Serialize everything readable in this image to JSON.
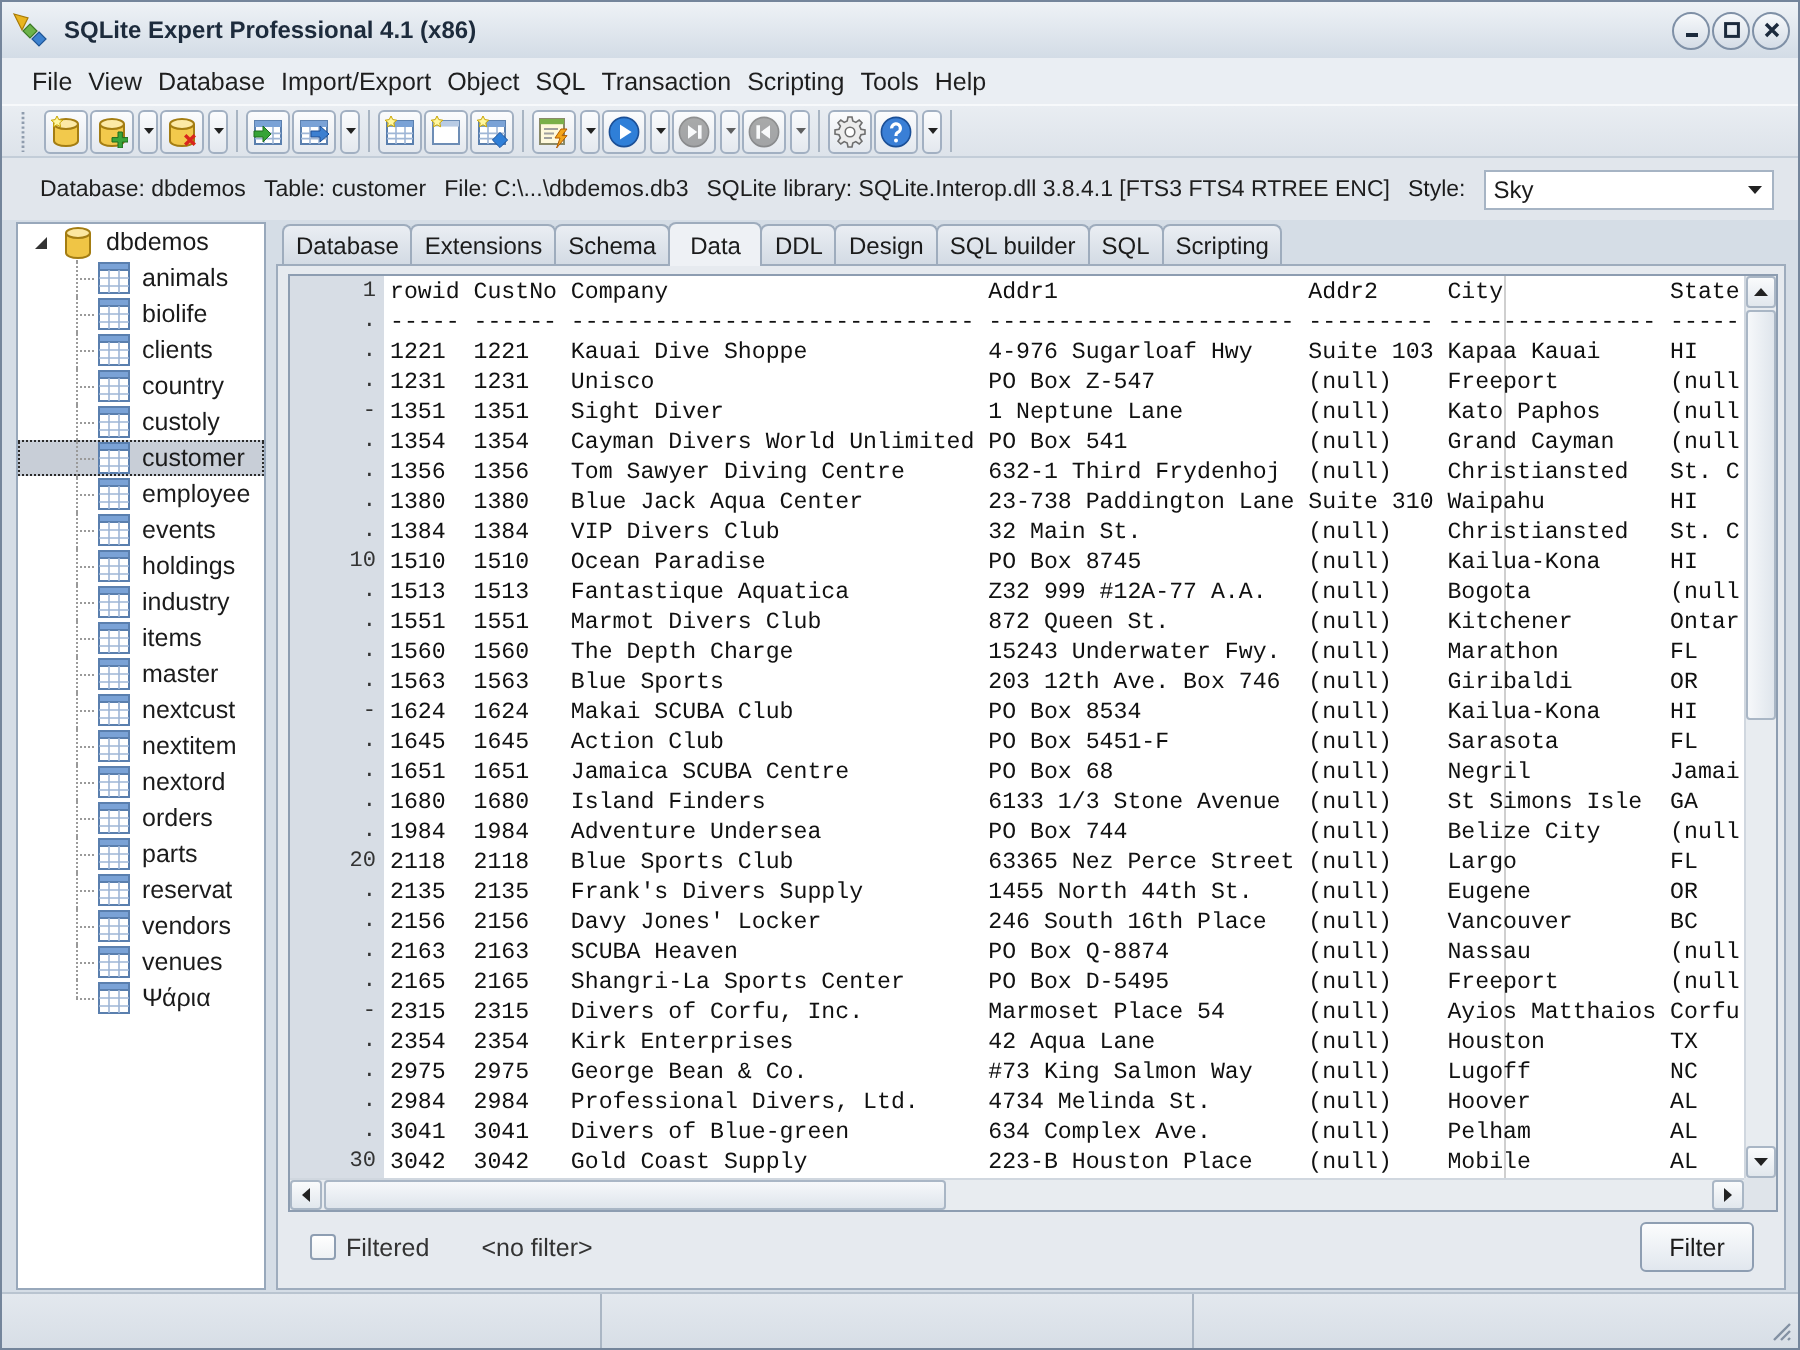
{
  "window": {
    "title": "SQLite Expert Professional 4.1 (x86)"
  },
  "menu": [
    "File",
    "View",
    "Database",
    "Import/Export",
    "Object",
    "SQL",
    "Transaction",
    "Scripting",
    "Tools",
    "Help"
  ],
  "toolbar": {
    "groups": [
      {
        "buttons": [
          {
            "kind": "newdb",
            "dropdown": false,
            "disabled": false
          },
          {
            "kind": "attachdb",
            "dropdown": true,
            "disabled": false
          },
          {
            "kind": "detachdb",
            "dropdown": true,
            "disabled": false
          }
        ]
      },
      {
        "buttons": [
          {
            "kind": "import",
            "dropdown": false,
            "disabled": false
          },
          {
            "kind": "export",
            "dropdown": true,
            "disabled": false
          }
        ]
      },
      {
        "buttons": [
          {
            "kind": "newtable",
            "dropdown": false,
            "disabled": false
          },
          {
            "kind": "newview",
            "dropdown": false,
            "disabled": false
          },
          {
            "kind": "newindex",
            "dropdown": false,
            "disabled": false
          }
        ]
      },
      {
        "buttons": [
          {
            "kind": "script",
            "dropdown": true,
            "disabled": false
          },
          {
            "kind": "play",
            "dropdown": true,
            "disabled": false
          },
          {
            "kind": "skipnext",
            "dropdown": true,
            "disabled": true
          },
          {
            "kind": "skipprev",
            "dropdown": true,
            "disabled": true
          }
        ]
      },
      {
        "buttons": [
          {
            "kind": "settings",
            "dropdown": false,
            "disabled": false
          },
          {
            "kind": "help",
            "dropdown": true,
            "disabled": false
          }
        ]
      }
    ]
  },
  "info_bar": {
    "items": [
      "Database: dbdemos",
      "Table: customer",
      "File: C:\\...\\dbdemos.db3",
      "SQLite library: SQLite.Interop.dll 3.8.4.1 [FTS3 FTS4 RTREE ENC]"
    ],
    "style": {
      "label": "Style:",
      "value": "Sky"
    }
  },
  "tree": {
    "label": "dbdemos",
    "expanded": true,
    "selected": false,
    "children": [
      {
        "label": "animals",
        "selected": false
      },
      {
        "label": "biolife",
        "selected": false
      },
      {
        "label": "clients",
        "selected": false
      },
      {
        "label": "country",
        "selected": false
      },
      {
        "label": "custoly",
        "selected": false
      },
      {
        "label": "customer",
        "selected": true
      },
      {
        "label": "employee",
        "selected": false
      },
      {
        "label": "events",
        "selected": false
      },
      {
        "label": "holdings",
        "selected": false
      },
      {
        "label": "industry",
        "selected": false
      },
      {
        "label": "items",
        "selected": false
      },
      {
        "label": "master",
        "selected": false
      },
      {
        "label": "nextcust",
        "selected": false
      },
      {
        "label": "nextitem",
        "selected": false
      },
      {
        "label": "nextord",
        "selected": false
      },
      {
        "label": "orders",
        "selected": false
      },
      {
        "label": "parts",
        "selected": false
      },
      {
        "label": "reservat",
        "selected": false
      },
      {
        "label": "vendors",
        "selected": false
      },
      {
        "label": "venues",
        "selected": false
      },
      {
        "label": "Ψάρια",
        "selected": false
      }
    ]
  },
  "tabs": [
    {
      "label": "Database",
      "selected": false
    },
    {
      "label": "Extensions",
      "selected": false
    },
    {
      "label": "Schema",
      "selected": false
    },
    {
      "label": "Data",
      "selected": true
    },
    {
      "label": "DDL",
      "selected": false
    },
    {
      "label": "Design",
      "selected": false
    },
    {
      "label": "SQL builder",
      "selected": false
    },
    {
      "label": "SQL",
      "selected": false
    },
    {
      "label": "Scripting",
      "selected": false
    }
  ],
  "editor": {
    "header": {
      "gutter": "1",
      "cells": [
        "rowid",
        "CustNo",
        "Company",
        "Addr1",
        "Addr2",
        "City",
        "State"
      ]
    },
    "rule": {
      "gutter": ".",
      "cells": [
        "-----",
        "------",
        "-----------------------------",
        "----------------------",
        "---------",
        "---------------",
        "-----"
      ]
    },
    "rows": [
      {
        "gutter": ".",
        "cells": [
          "1221",
          "1221",
          "Kauai Dive Shoppe",
          "4-976 Sugarloaf Hwy",
          "Suite 103",
          "Kapaa Kauai",
          "HI"
        ]
      },
      {
        "gutter": ".",
        "cells": [
          "1231",
          "1231",
          "Unisco",
          "PO Box Z-547",
          "(null)",
          "Freeport",
          "(null"
        ]
      },
      {
        "gutter": "-",
        "cells": [
          "1351",
          "1351",
          "Sight Diver",
          "1 Neptune Lane",
          "(null)",
          "Kato Paphos",
          "(null"
        ]
      },
      {
        "gutter": ".",
        "cells": [
          "1354",
          "1354",
          "Cayman Divers World Unlimited",
          "PO Box 541",
          "(null)",
          "Grand Cayman",
          "(null"
        ]
      },
      {
        "gutter": ".",
        "cells": [
          "1356",
          "1356",
          "Tom Sawyer Diving Centre",
          "632-1 Third Frydenhoj",
          "(null)",
          "Christiansted",
          "St. C"
        ]
      },
      {
        "gutter": ".",
        "cells": [
          "1380",
          "1380",
          "Blue Jack Aqua Center",
          "23-738 Paddington Lane",
          "Suite 310",
          "Waipahu",
          "HI"
        ]
      },
      {
        "gutter": ".",
        "cells": [
          "1384",
          "1384",
          "VIP Divers Club",
          "32 Main St.",
          "(null)",
          "Christiansted",
          "St. C"
        ]
      },
      {
        "gutter": "10",
        "cells": [
          "1510",
          "1510",
          "Ocean Paradise",
          "PO Box 8745",
          "(null)",
          "Kailua-Kona",
          "HI"
        ]
      },
      {
        "gutter": ".",
        "cells": [
          "1513",
          "1513",
          "Fantastique Aquatica",
          "Z32 999 #12A-77 A.A.",
          "(null)",
          "Bogota",
          "(null"
        ]
      },
      {
        "gutter": ".",
        "cells": [
          "1551",
          "1551",
          "Marmot Divers Club",
          "872 Queen St.",
          "(null)",
          "Kitchener",
          "Ontar"
        ]
      },
      {
        "gutter": ".",
        "cells": [
          "1560",
          "1560",
          "The Depth Charge",
          "15243 Underwater Fwy.",
          "(null)",
          "Marathon",
          "FL"
        ]
      },
      {
        "gutter": ".",
        "cells": [
          "1563",
          "1563",
          "Blue Sports",
          "203 12th Ave. Box 746",
          "(null)",
          "Giribaldi",
          "OR"
        ]
      },
      {
        "gutter": "-",
        "cells": [
          "1624",
          "1624",
          "Makai SCUBA Club",
          "PO Box 8534",
          "(null)",
          "Kailua-Kona",
          "HI"
        ]
      },
      {
        "gutter": ".",
        "cells": [
          "1645",
          "1645",
          "Action Club",
          "PO Box 5451-F",
          "(null)",
          "Sarasota",
          "FL"
        ]
      },
      {
        "gutter": ".",
        "cells": [
          "1651",
          "1651",
          "Jamaica SCUBA Centre",
          "PO Box 68",
          "(null)",
          "Negril",
          "Jamai"
        ]
      },
      {
        "gutter": ".",
        "cells": [
          "1680",
          "1680",
          "Island Finders",
          "6133 1/3 Stone Avenue",
          "(null)",
          "St Simons Isle",
          "GA"
        ]
      },
      {
        "gutter": ".",
        "cells": [
          "1984",
          "1984",
          "Adventure Undersea",
          "PO Box 744",
          "(null)",
          "Belize City",
          "(null"
        ]
      },
      {
        "gutter": "20",
        "cells": [
          "2118",
          "2118",
          "Blue Sports Club",
          "63365 Nez Perce Street",
          "(null)",
          "Largo",
          "FL"
        ]
      },
      {
        "gutter": ".",
        "cells": [
          "2135",
          "2135",
          "Frank's Divers Supply",
          "1455 North 44th St.",
          "(null)",
          "Eugene",
          "OR"
        ]
      },
      {
        "gutter": ".",
        "cells": [
          "2156",
          "2156",
          "Davy Jones' Locker",
          "246 South 16th Place",
          "(null)",
          "Vancouver",
          "BC"
        ]
      },
      {
        "gutter": ".",
        "cells": [
          "2163",
          "2163",
          "SCUBA Heaven",
          "PO Box Q-8874",
          "(null)",
          "Nassau",
          "(null"
        ]
      },
      {
        "gutter": ".",
        "cells": [
          "2165",
          "2165",
          "Shangri-La Sports Center",
          "PO Box D-5495",
          "(null)",
          "Freeport",
          "(null"
        ]
      },
      {
        "gutter": "-",
        "cells": [
          "2315",
          "2315",
          "Divers of Corfu, Inc.",
          "Marmoset Place 54",
          "(null)",
          "Ayios Matthaios",
          "Corfu"
        ]
      },
      {
        "gutter": ".",
        "cells": [
          "2354",
          "2354",
          "Kirk Enterprises",
          "42 Aqua Lane",
          "(null)",
          "Houston",
          "TX"
        ]
      },
      {
        "gutter": ".",
        "cells": [
          "2975",
          "2975",
          "George Bean & Co.",
          "#73 King Salmon Way",
          "(null)",
          "Lugoff",
          "NC"
        ]
      },
      {
        "gutter": ".",
        "cells": [
          "2984",
          "2984",
          "Professional Divers, Ltd.",
          "4734 Melinda St.",
          "(null)",
          "Hoover",
          "AL"
        ]
      },
      {
        "gutter": ".",
        "cells": [
          "3041",
          "3041",
          "Divers of Blue-green",
          "634 Complex Ave.",
          "(null)",
          "Pelham",
          "AL"
        ]
      },
      {
        "gutter": "30",
        "cells": [
          "3042",
          "3042",
          "Gold Coast Supply",
          "223-B Houston Place",
          "(null)",
          "Mobile",
          "AL"
        ]
      }
    ]
  },
  "filter": {
    "label": "Filtered",
    "checked": false,
    "text": "<no filter>",
    "button": "Filter"
  }
}
